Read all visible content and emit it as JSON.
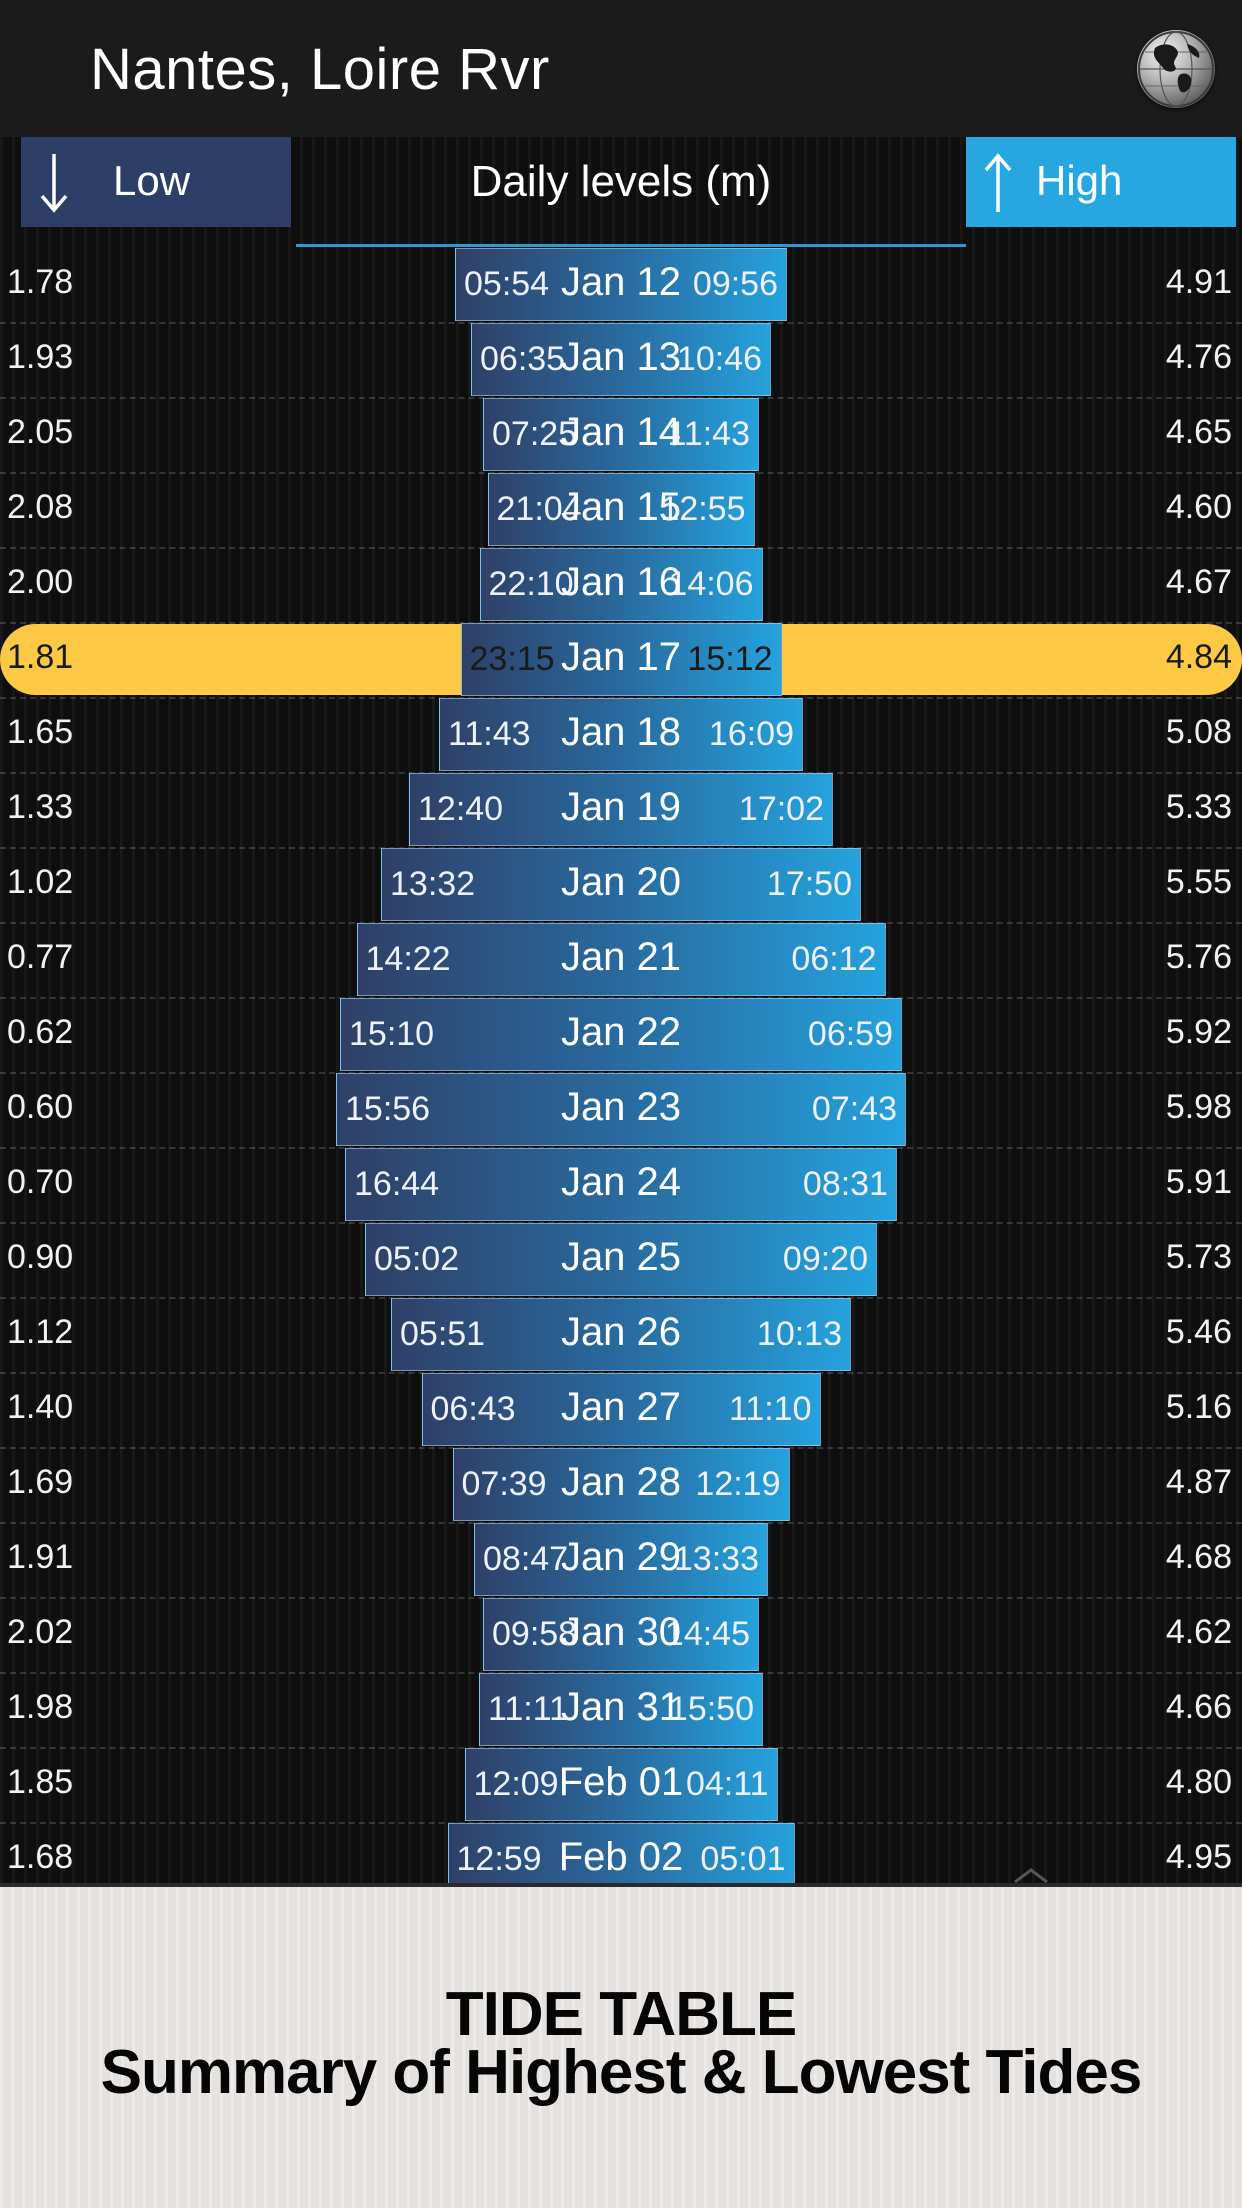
{
  "header": {
    "title": "Nantes, Loire Rvr",
    "globe_icon": "globe-icon"
  },
  "columns": {
    "low_label": "Low",
    "low_icon": "arrow-down-icon",
    "center_title": "Daily levels (m)",
    "high_label": "High",
    "high_icon": "arrow-up-icon",
    "low_color": "#2d3f66",
    "high_color": "#27a7e0"
  },
  "selected_date": "Jan 17",
  "highlight_color": "#fdc944",
  "rows": [
    {
      "date": "Jan 12",
      "low_time": "05:54",
      "high_time": "09:56",
      "low_level": "1.78",
      "high_level": "4.91"
    },
    {
      "date": "Jan 13",
      "low_time": "06:35",
      "high_time": "10:46",
      "low_level": "1.93",
      "high_level": "4.76"
    },
    {
      "date": "Jan 14",
      "low_time": "07:25",
      "high_time": "11:43",
      "low_level": "2.05",
      "high_level": "4.65"
    },
    {
      "date": "Jan 15",
      "low_time": "21:04",
      "high_time": "12:55",
      "low_level": "2.08",
      "high_level": "4.60"
    },
    {
      "date": "Jan 16",
      "low_time": "22:10",
      "high_time": "14:06",
      "low_level": "2.00",
      "high_level": "4.67"
    },
    {
      "date": "Jan 17",
      "low_time": "23:15",
      "high_time": "15:12",
      "low_level": "1.81",
      "high_level": "4.84"
    },
    {
      "date": "Jan 18",
      "low_time": "11:43",
      "high_time": "16:09",
      "low_level": "1.65",
      "high_level": "5.08"
    },
    {
      "date": "Jan 19",
      "low_time": "12:40",
      "high_time": "17:02",
      "low_level": "1.33",
      "high_level": "5.33"
    },
    {
      "date": "Jan 20",
      "low_time": "13:32",
      "high_time": "17:50",
      "low_level": "1.02",
      "high_level": "5.55"
    },
    {
      "date": "Jan 21",
      "low_time": "14:22",
      "high_time": "06:12",
      "low_level": "0.77",
      "high_level": "5.76"
    },
    {
      "date": "Jan 22",
      "low_time": "15:10",
      "high_time": "06:59",
      "low_level": "0.62",
      "high_level": "5.92"
    },
    {
      "date": "Jan 23",
      "low_time": "15:56",
      "high_time": "07:43",
      "low_level": "0.60",
      "high_level": "5.98"
    },
    {
      "date": "Jan 24",
      "low_time": "16:44",
      "high_time": "08:31",
      "low_level": "0.70",
      "high_level": "5.91"
    },
    {
      "date": "Jan 25",
      "low_time": "05:02",
      "high_time": "09:20",
      "low_level": "0.90",
      "high_level": "5.73"
    },
    {
      "date": "Jan 26",
      "low_time": "05:51",
      "high_time": "10:13",
      "low_level": "1.12",
      "high_level": "5.46"
    },
    {
      "date": "Jan 27",
      "low_time": "06:43",
      "high_time": "11:10",
      "low_level": "1.40",
      "high_level": "5.16"
    },
    {
      "date": "Jan 28",
      "low_time": "07:39",
      "high_time": "12:19",
      "low_level": "1.69",
      "high_level": "4.87"
    },
    {
      "date": "Jan 29",
      "low_time": "08:47",
      "high_time": "13:33",
      "low_level": "1.91",
      "high_level": "4.68"
    },
    {
      "date": "Jan 30",
      "low_time": "09:58",
      "high_time": "14:45",
      "low_level": "2.02",
      "high_level": "4.62"
    },
    {
      "date": "Jan 31",
      "low_time": "11:11",
      "high_time": "15:50",
      "low_level": "1.98",
      "high_level": "4.66"
    },
    {
      "date": "Feb 01",
      "low_time": "12:09",
      "high_time": "04:11",
      "low_level": "1.85",
      "high_level": "4.80"
    },
    {
      "date": "Feb 02",
      "low_time": "12:59",
      "high_time": "05:01",
      "low_level": "1.68",
      "high_level": "4.95"
    }
  ],
  "caption": {
    "title": "TIDE TABLE",
    "subtitle": "Summary of Highest & Lowest Tides"
  }
}
